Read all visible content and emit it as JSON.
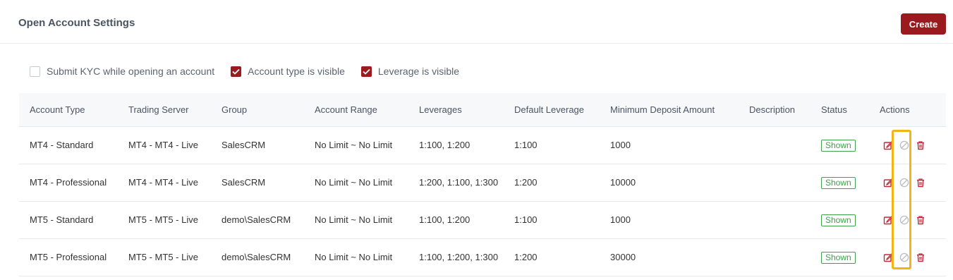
{
  "page": {
    "title": "Open Account Settings",
    "create_label": "Create"
  },
  "options": [
    {
      "label": "Submit KYC while opening an account",
      "checked": false
    },
    {
      "label": "Account type is visible",
      "checked": true
    },
    {
      "label": "Leverage is visible",
      "checked": true
    }
  ],
  "table": {
    "headers": {
      "account_type": "Account Type",
      "trading_server": "Trading Server",
      "group": "Group",
      "account_range": "Account Range",
      "leverages": "Leverages",
      "default_leverage": "Default Leverage",
      "min_deposit": "Minimum Deposit Amount",
      "description": "Description",
      "status": "Status",
      "actions": "Actions"
    },
    "rows": [
      {
        "account_type": "MT4 - Standard",
        "trading_server": "MT4 - MT4 - Live",
        "group": "SalesCRM",
        "account_range": "No Limit ~ No Limit",
        "leverages": "1:100, 1:200",
        "default_leverage": "1:100",
        "min_deposit": "1000",
        "description": "",
        "status": "Shown"
      },
      {
        "account_type": "MT4 - Professional",
        "trading_server": "MT4 - MT4 - Live",
        "group": "SalesCRM",
        "account_range": "No Limit ~ No Limit",
        "leverages": "1:200, 1:100, 1:300",
        "default_leverage": "1:200",
        "min_deposit": "10000",
        "description": "",
        "status": "Shown"
      },
      {
        "account_type": "MT5 - Standard",
        "trading_server": "MT5 - MT5 - Live",
        "group": "demo\\SalesCRM",
        "account_range": "No Limit ~ No Limit",
        "leverages": "1:100, 1:200",
        "default_leverage": "1:100",
        "min_deposit": "1000",
        "description": "",
        "status": "Shown"
      },
      {
        "account_type": "MT5 - Professional",
        "trading_server": "MT5 - MT5 - Live",
        "group": "demo\\SalesCRM",
        "account_range": "No Limit ~ No Limit",
        "leverages": "1:100, 1:200, 1:300",
        "default_leverage": "1:200",
        "min_deposit": "30000",
        "description": "",
        "status": "Shown"
      }
    ]
  },
  "icons": {
    "edit": "edit-icon",
    "disable": "disable-icon",
    "delete": "trash-icon"
  },
  "colors": {
    "accent": "#9b1a1d",
    "status_shown": "#3fa14a",
    "highlight": "#f2b515"
  }
}
